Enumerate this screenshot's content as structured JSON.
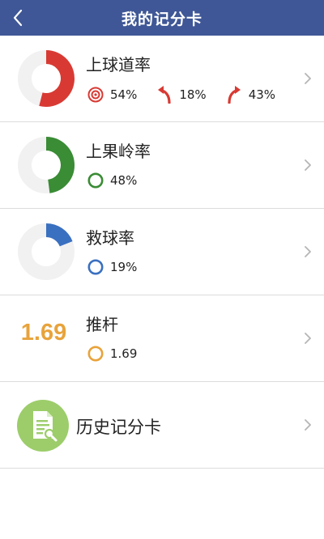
{
  "header": {
    "title": "我的记分卡"
  },
  "colors": {
    "header_bg": "#3f5796",
    "red": "#d83a33",
    "green": "#3a8c35",
    "blue": "#3a70c0",
    "orange": "#e8a33b",
    "history_green": "#9ccd6a"
  },
  "rows": [
    {
      "title": "上球道率",
      "percent": 54,
      "color": "#d83a33",
      "stats": [
        {
          "icon": "target-icon",
          "value": "54%"
        },
        {
          "icon": "curve-left-arrow-icon",
          "value": "18%"
        },
        {
          "icon": "curve-right-arrow-icon",
          "value": "43%"
        }
      ]
    },
    {
      "title": "上果岭率",
      "percent": 48,
      "color": "#3a8c35",
      "stats": [
        {
          "icon": "circle-icon",
          "value": "48%"
        }
      ]
    },
    {
      "title": "救球率",
      "percent": 19,
      "color": "#3a70c0",
      "stats": [
        {
          "icon": "circle-icon",
          "value": "19%"
        }
      ]
    },
    {
      "title": "推杆",
      "big_value": "1.69",
      "color": "#e8a33b",
      "stats": [
        {
          "icon": "circle-icon",
          "value": "1.69"
        }
      ]
    }
  ],
  "history": {
    "label": "历史记分卡",
    "icon": "document-search-icon"
  }
}
